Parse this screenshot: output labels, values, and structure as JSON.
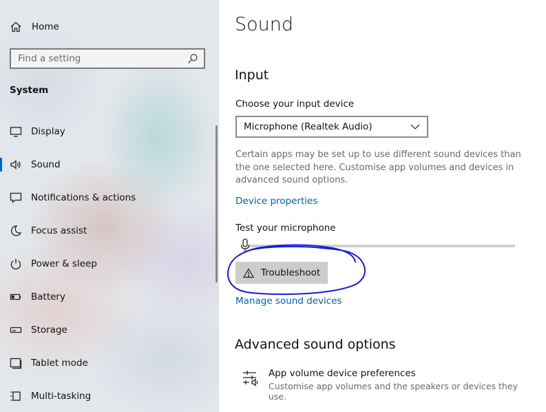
{
  "sidebar": {
    "home_label": "Home",
    "search_placeholder": "Find a setting",
    "section_label": "System",
    "items": [
      {
        "label": "Display",
        "icon": "display-icon"
      },
      {
        "label": "Sound",
        "icon": "speaker-icon",
        "active": true
      },
      {
        "label": "Notifications & actions",
        "icon": "notification-icon"
      },
      {
        "label": "Focus assist",
        "icon": "moon-icon"
      },
      {
        "label": "Power & sleep",
        "icon": "power-icon"
      },
      {
        "label": "Battery",
        "icon": "battery-icon"
      },
      {
        "label": "Storage",
        "icon": "storage-icon"
      },
      {
        "label": "Tablet mode",
        "icon": "tablet-icon"
      },
      {
        "label": "Multi-tasking",
        "icon": "multitasking-icon"
      }
    ]
  },
  "main": {
    "title": "Sound",
    "input": {
      "heading": "Input",
      "choose_label": "Choose your input device",
      "selected_device": "Microphone (Realtek Audio)",
      "description": "Certain apps may be set up to use different sound devices than the one selected here. Customise app volumes and devices in advanced sound options.",
      "device_properties_link": "Device properties",
      "test_label": "Test your microphone",
      "mic_level": 0,
      "troubleshoot_label": "Troubleshoot",
      "manage_link": "Manage sound devices"
    },
    "advanced": {
      "heading": "Advanced sound options",
      "app_volume_title": "App volume  device preferences",
      "app_volume_desc": "Customise app volumes and the speakers or devices they use."
    }
  },
  "colors": {
    "accent": "#0067c0",
    "link": "#0063b1",
    "annotation": "#1a1adb",
    "button_bg": "#cccccc"
  }
}
